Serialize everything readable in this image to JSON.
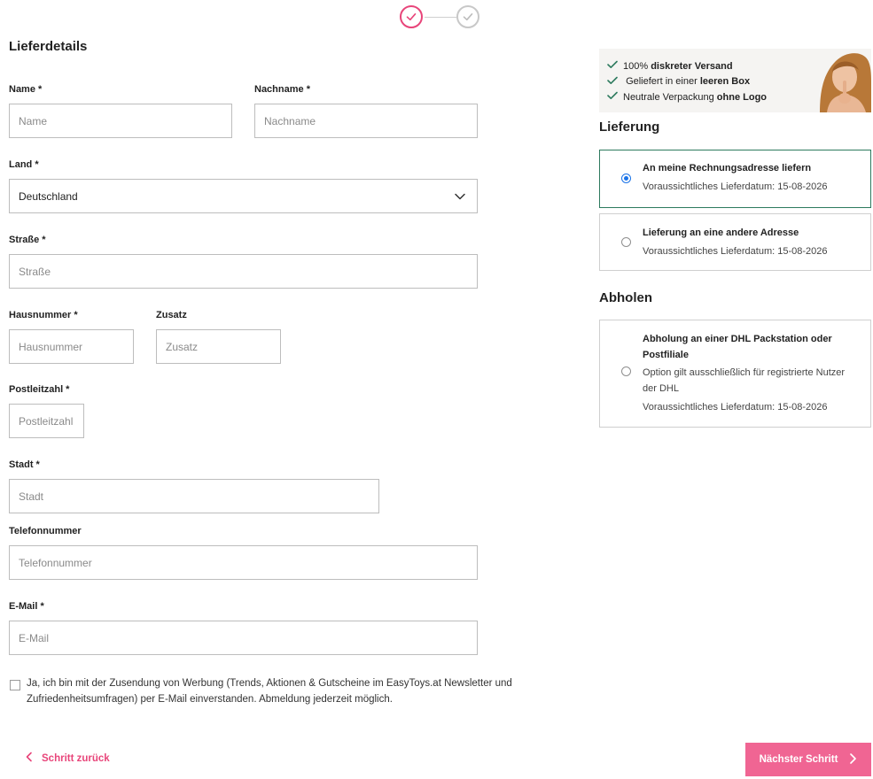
{
  "form": {
    "title": "Lieferdetails",
    "name": {
      "label": "Name *",
      "placeholder": "Name"
    },
    "lastname": {
      "label": "Nachname *",
      "placeholder": "Nachname"
    },
    "country": {
      "label": "Land *",
      "value": "Deutschland"
    },
    "street": {
      "label": "Straße *",
      "placeholder": "Straße"
    },
    "house": {
      "label": "Hausnummer *",
      "placeholder": "Hausnummer"
    },
    "addition": {
      "label": "Zusatz",
      "placeholder": "Zusatz"
    },
    "zip": {
      "label": "Postleitzahl *",
      "placeholder": "Postleitzahl"
    },
    "city": {
      "label": "Stadt *",
      "placeholder": "Stadt"
    },
    "phone": {
      "label": "Telefonnummer",
      "placeholder": "Telefonnummer"
    },
    "email": {
      "label": "E-Mail *",
      "placeholder": "E-Mail"
    },
    "newsletter_text": "Ja, ich bin mit der Zusendung von Werbung (Trends, Aktionen & Gutscheine im EasyToys.at Newsletter und Zufriedenheitsumfragen) per E-Mail einverstanden. Abmeldung jederzeit möglich."
  },
  "nav": {
    "back_label": "Schritt zurück",
    "next_label": "Nächster Schritt"
  },
  "banner": {
    "items": [
      {
        "pre": "100% ",
        "bold": "diskreter Versand",
        "post": ""
      },
      {
        "pre": "Geliefert in einer ",
        "bold": "leeren Box",
        "post": ""
      },
      {
        "pre": "Neutrale Verpackung ",
        "bold": "ohne Logo",
        "post": ""
      }
    ]
  },
  "delivery": {
    "title": "Lieferung",
    "options": [
      {
        "title": "An meine Rechnungsadresse liefern",
        "date": "Voraussichtliches Lieferdatum: 15-08-2026"
      },
      {
        "title": "Lieferung an eine andere Adresse",
        "date": "Voraussichtliches Lieferdatum: 15-08-2026"
      }
    ]
  },
  "pickup": {
    "title": "Abholen",
    "option": {
      "title_line1": "Abholung an einer DHL Packstation oder",
      "title_line2": "Postfiliale",
      "note_line1": "Option gilt ausschließlich für registrierte Nutzer",
      "note_line2": "der DHL",
      "date": "Voraussichtliches Lieferdatum: 15-08-2026"
    }
  },
  "colors": {
    "accent": "#e8457a",
    "button": "#f06593",
    "selected_border": "#2d7a5e",
    "radio": "#1a73e8"
  }
}
